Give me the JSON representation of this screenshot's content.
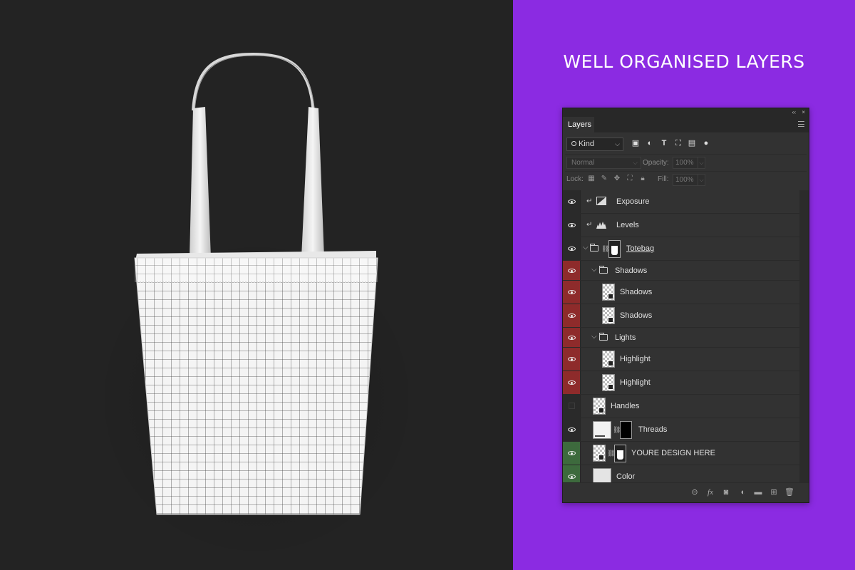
{
  "headline": "WELL ORGANISED LAYERS",
  "panel": {
    "collapse_glyph": "‹‹",
    "close_glyph": "×",
    "tab_label": "Layers",
    "filter_kind": "Kind",
    "blend_mode": "Normal",
    "opacity_label": "Opacity:",
    "opacity_value": "100%",
    "lock_label": "Lock:",
    "fill_label": "Fill:",
    "fill_value": "100%"
  },
  "layers": [
    {
      "name": "Exposure",
      "visible": true,
      "color": "none"
    },
    {
      "name": "Levels",
      "visible": true,
      "color": "none"
    },
    {
      "name": "Totebag",
      "visible": true,
      "color": "none"
    },
    {
      "name": "Shadows",
      "visible": true,
      "color": "red"
    },
    {
      "name": "Shadows",
      "visible": true,
      "color": "red"
    },
    {
      "name": "Shadows",
      "visible": true,
      "color": "red"
    },
    {
      "name": "Lights",
      "visible": true,
      "color": "red"
    },
    {
      "name": "Highlight",
      "visible": true,
      "color": "red"
    },
    {
      "name": "Highlight",
      "visible": true,
      "color": "red"
    },
    {
      "name": "Handles",
      "visible": false,
      "color": "none"
    },
    {
      "name": "Threads",
      "visible": true,
      "color": "none"
    },
    {
      "name": "YOURE DESIGN HERE",
      "visible": true,
      "color": "green"
    },
    {
      "name": "Color",
      "visible": true,
      "color": "green"
    }
  ],
  "colors": {
    "left_background": "#232323",
    "right_background": "#8b2be2",
    "panel_background": "#323232",
    "red_label": "#8e2b2b",
    "green_label": "#3d6a3d"
  }
}
